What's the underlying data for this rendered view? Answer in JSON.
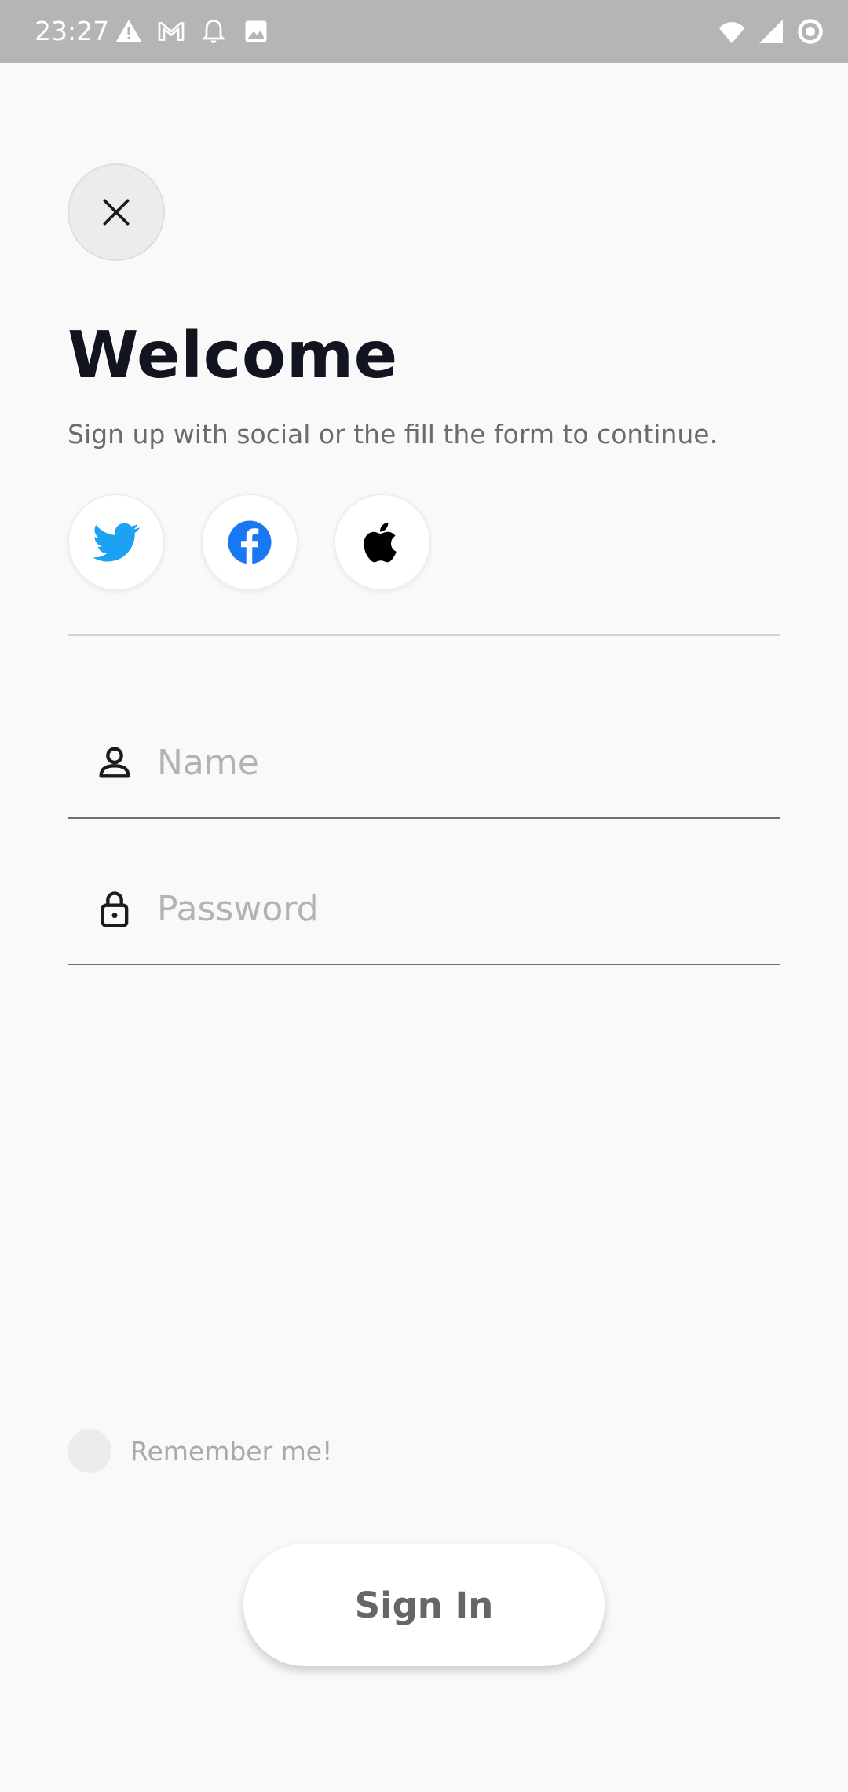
{
  "status_bar": {
    "time": "23:27",
    "left_icons": [
      "warning-icon",
      "gmail-icon",
      "notification-bell-icon",
      "image-icon"
    ],
    "right_icons": [
      "wifi-icon",
      "cellular-signal-icon",
      "sync-circle-icon"
    ]
  },
  "header": {
    "close_icon": "close-icon",
    "title": "Welcome",
    "subtitle": "Sign up with social or the fill the form to continue."
  },
  "social": [
    {
      "name": "twitter",
      "icon": "twitter-icon",
      "color": "#1DA1F2"
    },
    {
      "name": "facebook",
      "icon": "facebook-icon",
      "color": "#1877F2"
    },
    {
      "name": "apple",
      "icon": "apple-icon",
      "color": "#000000"
    }
  ],
  "form": {
    "name": {
      "placeholder": "Name",
      "value": "",
      "icon": "user-icon"
    },
    "password": {
      "placeholder": "Password",
      "value": "",
      "icon": "lock-icon"
    },
    "remember_label": "Remember me!",
    "remember_checked": false,
    "submit_label": "Sign In"
  },
  "colors": {
    "background": "#f9f9f9",
    "status_bar": "#b5b5b5",
    "title": "#121420",
    "subtitle": "#6b6b6b",
    "placeholder": "#b3b3b3"
  }
}
